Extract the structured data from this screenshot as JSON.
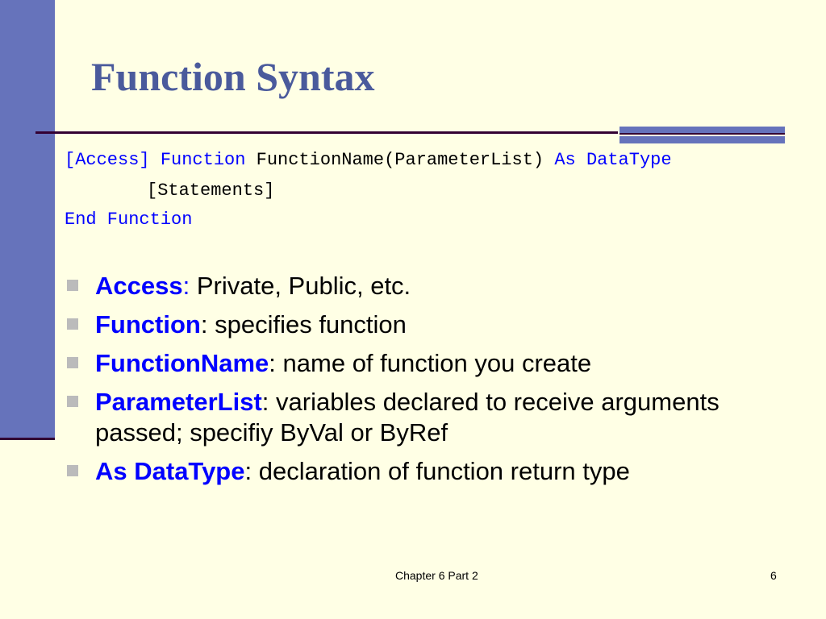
{
  "slide": {
    "title": "Function Syntax",
    "code": {
      "line1": {
        "access": "[Access]",
        "function": "Function",
        "name": "FunctionName(ParameterList)",
        "as": "As",
        "datatype": "DataType"
      },
      "line2": {
        "statements": "[Statements]"
      },
      "line3": {
        "end": "End Function"
      }
    },
    "bullets": [
      {
        "term": "Access",
        "text": " Private, Public, etc."
      },
      {
        "term": "Function",
        "text": " specifies function"
      },
      {
        "term": "FunctionName",
        "text": " name of function you create"
      },
      {
        "term": "ParameterList",
        "text": " variables declared to receive arguments passed; specifiy ByVal or ByRef"
      },
      {
        "term": "As DataType",
        "text": " declaration of function return type"
      }
    ],
    "footer": {
      "chapter": "Chapter 6 Part 2",
      "page": "6"
    }
  },
  "colors": {
    "background": "#FFFFE5",
    "accent_bar": "#6673BB",
    "title": "#4A5A9C",
    "keyword": "#0000FF",
    "rule": "#330033"
  }
}
